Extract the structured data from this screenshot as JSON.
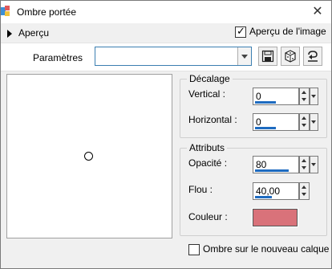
{
  "window": {
    "title": "Ombre portée"
  },
  "preview_toggle": {
    "label": "Aperçu"
  },
  "preview_checkbox": {
    "label": "Aperçu de l'image",
    "checked": true
  },
  "parameters": {
    "label": "Paramètres",
    "preset_value": ""
  },
  "toolbar": {
    "icons": [
      "save-icon",
      "randomize-icon",
      "reset-icon"
    ]
  },
  "offset": {
    "title": "Décalage",
    "vertical": {
      "label": "Vertical :",
      "value": "0",
      "level": 0.5
    },
    "horizontal": {
      "label": "Horizontal :",
      "value": "0",
      "level": 0.5
    }
  },
  "attributes": {
    "title": "Attributs",
    "opacity": {
      "label": "Opacité :",
      "value": "80",
      "level": 0.8
    },
    "blur": {
      "label": "Flou :",
      "value": "40,00",
      "level": 0.4
    },
    "color": {
      "label": "Couleur :",
      "value": "#d9727a"
    }
  },
  "new_layer_checkbox": {
    "label": "Ombre sur le nouveau calque",
    "checked": false
  }
}
